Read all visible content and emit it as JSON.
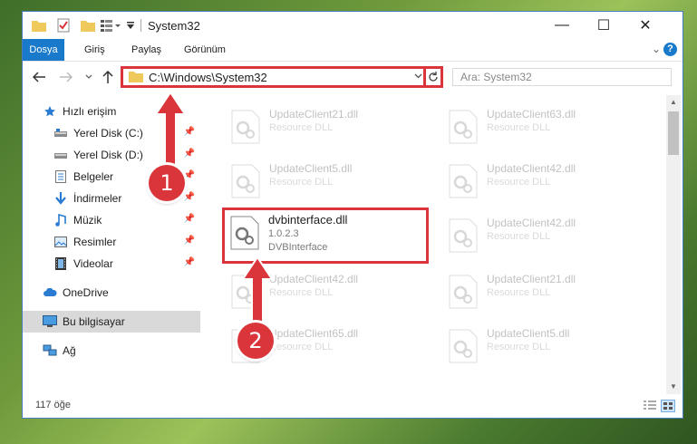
{
  "window": {
    "title": "System32",
    "minimize": "—",
    "maximize": "☐",
    "close": "✕"
  },
  "ribbon": {
    "tabs": [
      "Dosya",
      "Giriş",
      "Paylaş",
      "Görünüm"
    ],
    "expand": "⌄",
    "help": "?"
  },
  "navigation": {
    "address": "C:\\Windows\\System32",
    "search_placeholder": "Ara: System32"
  },
  "sidebar": {
    "items": [
      {
        "label": "Hızlı erişim",
        "icon": "star-icon"
      },
      {
        "label": "Yerel Disk (C:)",
        "icon": "drive-icon",
        "pinned": true
      },
      {
        "label": "Yerel Disk (D:)",
        "icon": "drive-icon",
        "pinned": true
      },
      {
        "label": "Belgeler",
        "icon": "document-icon",
        "pinned": true
      },
      {
        "label": "İndirmeler",
        "icon": "download-icon",
        "pinned": true
      },
      {
        "label": "Müzik",
        "icon": "music-icon",
        "pinned": true
      },
      {
        "label": "Resimler",
        "icon": "pictures-icon",
        "pinned": true
      },
      {
        "label": "Videolar",
        "icon": "video-icon",
        "pinned": true
      },
      {
        "label": "OneDrive",
        "icon": "cloud-icon"
      },
      {
        "label": "Bu bilgisayar",
        "icon": "computer-icon",
        "selected": true
      },
      {
        "label": "Ağ",
        "icon": "network-icon"
      }
    ]
  },
  "files": {
    "col1": [
      {
        "name": "UpdateClient21.dll",
        "type": "Resource DLL"
      },
      {
        "name": "UpdateClient5.dll",
        "type": "Resource DLL"
      },
      {
        "name": "dvbinterface.dll",
        "version": "1.0.2.3",
        "type": "DVBInterface"
      },
      {
        "name": "UpdateClient42.dll",
        "type": "Resource DLL"
      },
      {
        "name": "UpdateClient65.dll",
        "type": "Resource DLL"
      }
    ],
    "col2": [
      {
        "name": "UpdateClient63.dll",
        "type": "Resource DLL"
      },
      {
        "name": "UpdateClient42.dll",
        "type": "Resource DLL"
      },
      {
        "name": "UpdateClient42.dll",
        "type": "Resource DLL"
      },
      {
        "name": "UpdateClient21.dll",
        "type": "Resource DLL"
      },
      {
        "name": "UpdateClient5.dll",
        "type": "Resource DLL"
      }
    ]
  },
  "status": {
    "item_count": "117 öğe"
  },
  "annotations": {
    "step1": "1",
    "step2": "2",
    "color": "#d9353b"
  }
}
